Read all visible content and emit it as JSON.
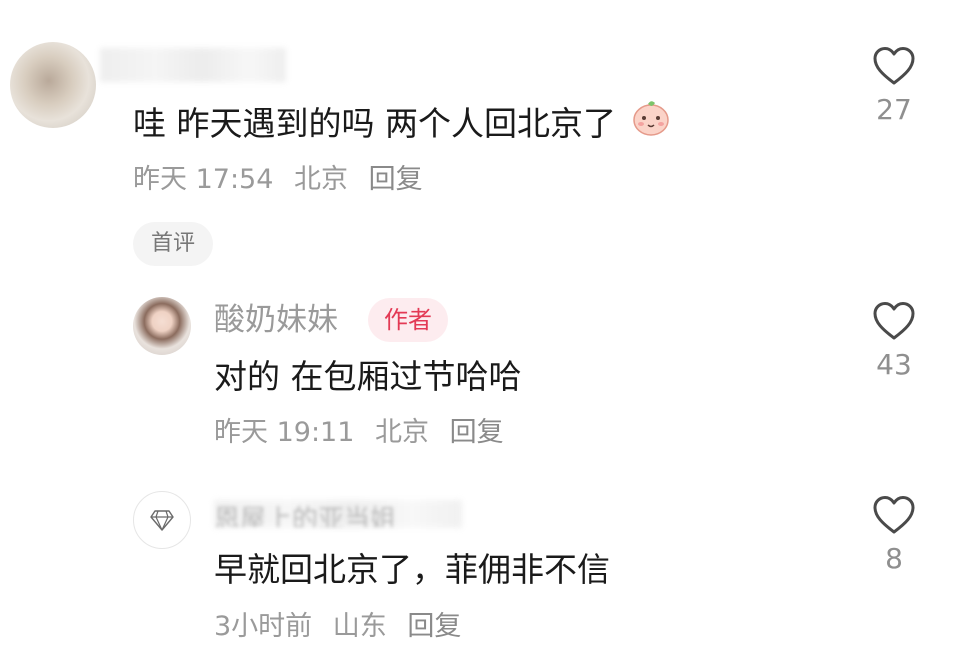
{
  "comments": [
    {
      "text": "哇 昨天遇到的吗 两个人回北京了",
      "emoji": "peach-face-emoji",
      "time": "昨天 17:54",
      "location": "北京",
      "reply_label": "回复",
      "tag": "首评",
      "likes": "27"
    },
    {
      "author": "酸奶妹妹",
      "badge": "作者",
      "text": "对的 在包厢过节哈哈",
      "time": "昨天 19:11",
      "location": "北京",
      "reply_label": "回复",
      "likes": "43"
    },
    {
      "author": "恩屋上的亚当姐",
      "text": "早就回北京了，菲佣非不信",
      "time": "3小时前",
      "location": "山东",
      "reply_label": "回复",
      "likes": "8"
    }
  ],
  "colors": {
    "author_badge_text": "#e33a55",
    "author_badge_bg": "#fdecef",
    "meta_text": "#9a9a9a",
    "content_text": "#1a1a1a"
  }
}
